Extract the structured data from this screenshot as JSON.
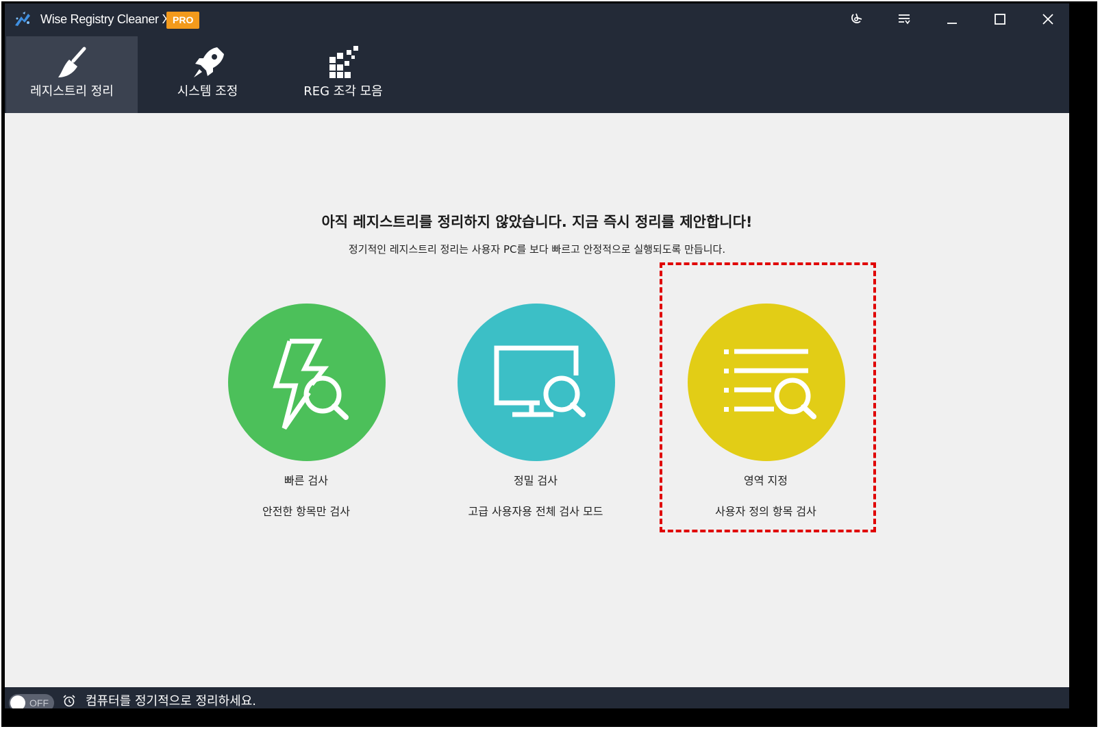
{
  "titlebar": {
    "app_title": "Wise Registry Cleaner X",
    "badge": "PRO",
    "controls": [
      "settings-icon",
      "menu-icon",
      "minimize-icon",
      "maximize-icon",
      "close-icon"
    ]
  },
  "nav": {
    "tabs": [
      {
        "label": "레지스트리 정리",
        "icon": "broom-icon",
        "active": true
      },
      {
        "label": "시스템 조정",
        "icon": "rocket-icon",
        "active": false
      },
      {
        "label": "REG 조각 모음",
        "icon": "defrag-blocks-icon",
        "active": false
      }
    ]
  },
  "main": {
    "headline": "아직 레지스트리를 정리하지 않았습니다. 지금 즉시 정리를 제안합니다!",
    "subline": "정기적인 레지스트리 정리는 사용자 PC를 보다 빠르고 안정적으로 실행되도록 만듭니다.",
    "options": [
      {
        "title": "빠른 검사",
        "desc": "안전한 항목만 검사",
        "icon": "lightning-search-icon",
        "color": "#4cc05a"
      },
      {
        "title": "정밀 검사",
        "desc": "고급 사용자용 전체 검사 모드",
        "icon": "monitor-search-icon",
        "color": "#3cbfc6"
      },
      {
        "title": "영역 지정",
        "desc": "사용자 정의 항목 검사",
        "icon": "list-search-icon",
        "color": "#e2cd16"
      }
    ]
  },
  "statusbar": {
    "toggle_state": "OFF",
    "schedule_text": "컴퓨터를 정기적으로 정리하세요."
  },
  "colors": {
    "topbar": "#232a37",
    "active_tab": "#3b4250",
    "badge": "#f39a1c",
    "highlight": "#e00000"
  }
}
